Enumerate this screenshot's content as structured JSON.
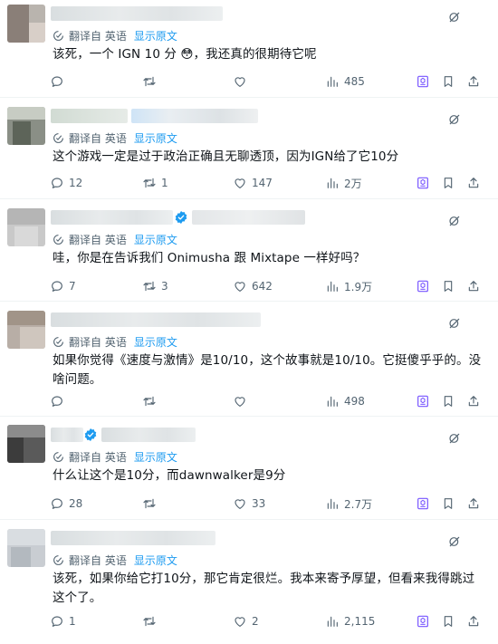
{
  "translation": {
    "translated_from": "翻译自 英语",
    "show_original": "显示原文"
  },
  "icons": {
    "reply": "reply-icon",
    "retweet": "retweet-icon",
    "like": "like-icon",
    "views": "views-icon",
    "grok": "grok-icon",
    "bookmark": "bookmark-icon",
    "share": "share-icon",
    "verified": "verified-badge-icon"
  },
  "colors": {
    "link": "#1d9bf0",
    "muted": "#536471",
    "grok_accent": "#7856ff"
  },
  "posts": [
    {
      "text": "该死，一个 IGN 10 分 😳，我还真的很期待它呢",
      "replies": "",
      "retweets": "",
      "likes": "",
      "views": "485",
      "verified": false
    },
    {
      "text": "这个游戏一定是过于政治正确且无聊透顶，因为IGN给了它10分",
      "replies": "12",
      "retweets": "1",
      "likes": "147",
      "views": "2万",
      "verified": false
    },
    {
      "text": "哇，你是在告诉我们 Onimusha 跟 Mixtape 一样好吗？",
      "replies": "7",
      "retweets": "3",
      "likes": "642",
      "views": "1.9万",
      "verified": true
    },
    {
      "text": "如果你觉得《速度与激情》是10/10，这个故事就是10/10。它挺傻乎乎的。没啥问题。",
      "replies": "",
      "retweets": "",
      "likes": "",
      "views": "498",
      "verified": false
    },
    {
      "text": "什么让这个是10分，而dawnwalker是9分",
      "replies": "28",
      "retweets": "",
      "likes": "33",
      "views": "2.7万",
      "verified": true
    },
    {
      "text": "该死，如果你给它打10分，那它肯定很烂。我本来寄予厚望，但看来我得跳过这个了。",
      "replies": "1",
      "retweets": "",
      "likes": "2",
      "views": "2,115",
      "verified": false
    }
  ]
}
